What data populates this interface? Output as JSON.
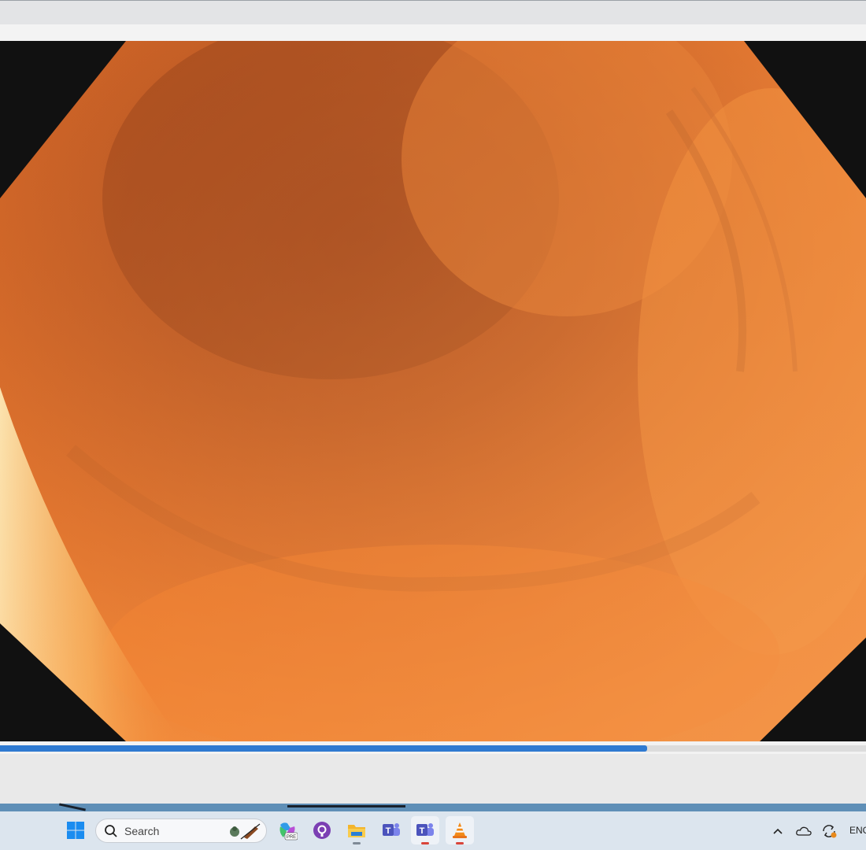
{
  "window": {
    "playback_progress": 0.747
  },
  "taskbar": {
    "search_placeholder": "Search",
    "language": "ENG",
    "apps": [
      {
        "name": "windows-start",
        "icon": "windows-logo-icon",
        "active": false
      },
      {
        "name": "copilot",
        "icon": "copilot-pre-icon",
        "active": false
      },
      {
        "name": "github-desktop",
        "icon": "github-icon",
        "active": false
      },
      {
        "name": "file-explorer",
        "icon": "folder-icon",
        "active": false
      },
      {
        "name": "teams-classic",
        "icon": "teams-icon",
        "active": false
      },
      {
        "name": "teams",
        "icon": "teams-icon",
        "active": true
      },
      {
        "name": "vlc",
        "icon": "vlc-cone-icon",
        "active": true
      }
    ],
    "tray_icons": [
      "chevron-up-icon",
      "onedrive-cloud-icon",
      "sync-icon"
    ]
  },
  "colors": {
    "seek_fill": "#2f7ad1",
    "taskbar_bg": "#dce5ee",
    "video_tissue": "#e7772c"
  }
}
